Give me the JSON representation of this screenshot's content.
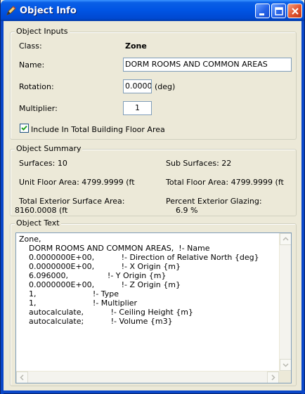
{
  "window": {
    "title": "Object Info"
  },
  "inputs": {
    "legend": "Object Inputs",
    "class_label": "Class:",
    "class_value": "Zone",
    "name_label": "Name:",
    "name_value": "DORM ROOMS AND COMMON AREAS",
    "rotation_label": "Rotation:",
    "rotation_value": "0.00000",
    "rotation_unit": "(deg)",
    "multiplier_label": "Multiplier:",
    "multiplier_value": "1",
    "floor_area_checkbox_label": "Include In Total Building Floor Area",
    "floor_area_checked": true
  },
  "summary": {
    "legend": "Object Summary",
    "surfaces": "Surfaces:   10",
    "sub_surfaces": "Sub Surfaces:   22",
    "unit_floor_area": "Unit Floor Area: 4799.9999 (ft",
    "total_floor_area": "Total Floor Area:  4799.9999 (ft",
    "total_ext_area_label": "Total Exterior Surface Area:",
    "total_ext_area_value": "8160.0008 (ft",
    "pct_glazing_label": "Percent Exterior Glazing:",
    "pct_glazing_value": "6.9 %"
  },
  "text": {
    "legend": "Object Text",
    "lines": [
      "Zone,",
      "    DORM ROOMS AND COMMON AREAS,  !- Name",
      "    0.0000000E+00,           !- Direction of Relative North {deg}",
      "    0.0000000E+00,           !- X Origin {m}",
      "    6.096000,                !- Y Origin {m}",
      "    0.0000000E+00,           !- Z Origin {m}",
      "    1,                       !- Type",
      "    1,                       !- Multiplier",
      "    autocalculate,           !- Ceiling Height {m}",
      "    autocalculate;           !- Volume {m3}"
    ]
  },
  "icons": {
    "title": "pencil-icon",
    "minimize": "minimize-icon",
    "maximize": "maximize-icon",
    "close": "close-icon"
  }
}
